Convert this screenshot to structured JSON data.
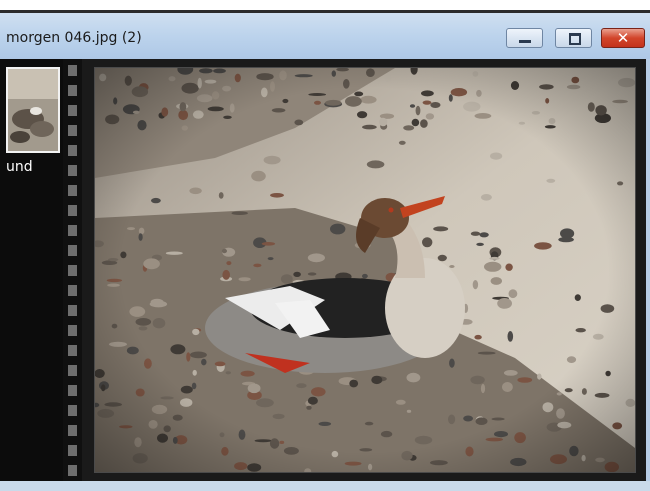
{
  "window": {
    "title": "morgen 046.jpg (2)",
    "controls": {
      "minimize": "minimize",
      "maximize": "maximize",
      "close": "✕"
    }
  },
  "filmstrip": {
    "thumbnail_label": "und"
  },
  "viewer": {
    "image_subject": "merganser-on-pebble-beach"
  },
  "colors": {
    "titlebar": "#bcd3ec",
    "close_button": "#c4321b",
    "sidebar": "#0c0c0c",
    "viewer_bg": "#1a1a1a"
  }
}
